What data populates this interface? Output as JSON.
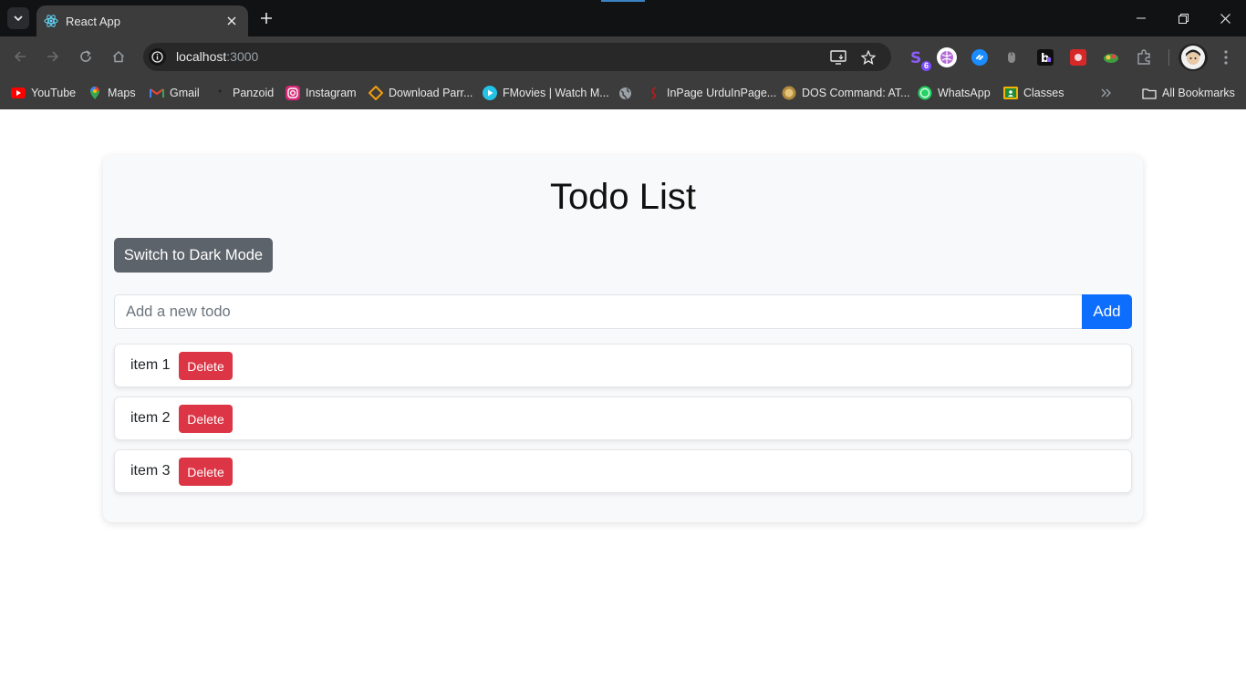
{
  "browser": {
    "tab": {
      "title": "React App"
    },
    "address_bar": {
      "host": "localhost",
      "port": ":3000"
    },
    "extensions": {
      "badge_count": "6"
    },
    "bookmarks": [
      {
        "label": "YouTube",
        "icon": "youtube-icon"
      },
      {
        "label": "Maps",
        "icon": "maps-pin-icon"
      },
      {
        "label": "Gmail",
        "icon": "gmail-icon"
      },
      {
        "label": "Panzoid",
        "icon": "panzoid-icon"
      },
      {
        "label": "Instagram",
        "icon": "instagram-icon"
      },
      {
        "label": "Download Parr...",
        "icon": "diamond-icon"
      },
      {
        "label": "FMovies | Watch M...",
        "icon": "play-icon"
      },
      {
        "label": "",
        "icon": "globe-icon"
      },
      {
        "label": "InPage UrduInPage...",
        "icon": "inpage-icon"
      },
      {
        "label": "DOS Command: AT...",
        "icon": "dos-icon"
      },
      {
        "label": "WhatsApp",
        "icon": "whatsapp-icon"
      },
      {
        "label": "Classes",
        "icon": "classroom-icon"
      }
    ],
    "all_bookmarks": "All Bookmarks"
  },
  "app": {
    "title": "Todo List",
    "mode_button": "Switch to Dark Mode",
    "input": {
      "placeholder": "Add a new todo",
      "value": ""
    },
    "add_button": "Add",
    "todos": [
      {
        "text": "item 1",
        "delete_label": "Delete"
      },
      {
        "text": "item 2",
        "delete_label": "Delete"
      },
      {
        "text": "item 3",
        "delete_label": "Delete"
      }
    ]
  },
  "colors": {
    "primary": "#0d6efd",
    "danger": "#dc3545",
    "secondary": "#5c636a",
    "card_bg": "#f8f9fa"
  }
}
